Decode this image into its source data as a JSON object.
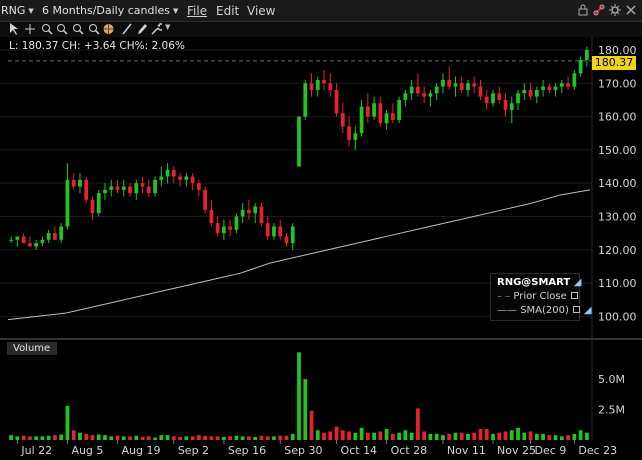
{
  "header": {
    "symbol": "RNG",
    "period": "6 Months/Daily candles",
    "menus": [
      "File",
      "Edit",
      "View"
    ]
  },
  "window_icons": [
    "lock-icon",
    "link-icon",
    "settings-icon",
    "close-icon"
  ],
  "toolbar_tools": [
    "pointer-icon",
    "crosshair-icon",
    "zoom-in-icon",
    "zoom-out-icon",
    "line-tool-icon",
    "annotate-icon",
    "wrench-icon"
  ],
  "ohlc_readout": "L: 180.37  CH: +3.64  CH%: 2.06%",
  "last_price_tag": "180.37",
  "legend": {
    "title": "RNG@SMART",
    "items": [
      {
        "label": "Prior Close",
        "checked": true
      },
      {
        "label": "SMA(200)",
        "checked": true
      }
    ]
  },
  "volume_panel": {
    "label": "Volume"
  },
  "colors": {
    "up": "#22c51e",
    "down": "#e8222a",
    "sma": "#bdbdbd",
    "price_tag": "#f3d21d",
    "grid": "#1b1b1b"
  },
  "chart_data": {
    "type": "candlestick",
    "y_ticks": [
      "180.00",
      "170.00",
      "160.00",
      "150.00",
      "140.00",
      "130.00",
      "120.00",
      "110.00",
      "100.00"
    ],
    "ylim": [
      95,
      183
    ],
    "x_ticks": [
      "Jul 22",
      "Aug 5",
      "Aug 19",
      "Sep 2",
      "Sep 16",
      "Sep 30",
      "Oct 14",
      "Oct 28",
      "Nov 11",
      "Nov 25",
      "Dec 9",
      "Dec 23"
    ],
    "volume_ticks": [
      "5.0M",
      "2.5M"
    ],
    "prior_close": 176.73,
    "sma_200": [
      99,
      100,
      101,
      103,
      105,
      107,
      109,
      111,
      113,
      116,
      118,
      120,
      122,
      124,
      126,
      128,
      130,
      132,
      134,
      136.5,
      138
    ],
    "candles": [
      [
        123,
        124,
        122,
        123
      ],
      [
        123,
        124,
        121,
        124
      ],
      [
        124,
        125,
        122,
        122
      ],
      [
        122,
        124,
        121,
        121
      ],
      [
        121,
        123,
        120,
        122
      ],
      [
        122,
        124,
        121,
        123
      ],
      [
        123,
        126,
        122,
        125
      ],
      [
        125,
        127,
        123,
        123
      ],
      [
        123,
        128,
        122,
        127
      ],
      [
        127,
        146,
        126,
        141
      ],
      [
        141,
        143,
        138,
        139
      ],
      [
        139,
        143,
        137,
        141
      ],
      [
        141,
        142,
        134,
        135
      ],
      [
        135,
        136,
        129,
        131
      ],
      [
        131,
        138,
        130,
        137
      ],
      [
        137,
        140,
        135,
        138
      ],
      [
        138,
        141,
        136,
        139
      ],
      [
        139,
        141,
        137,
        138
      ],
      [
        138,
        141,
        136,
        139
      ],
      [
        139,
        140,
        136,
        137
      ],
      [
        137,
        141,
        135,
        140
      ],
      [
        140,
        142,
        137,
        139
      ],
      [
        139,
        141,
        136,
        137
      ],
      [
        137,
        142,
        136,
        141
      ],
      [
        141,
        145,
        139,
        142
      ],
      [
        142,
        146,
        140,
        144
      ],
      [
        144,
        145,
        140,
        142
      ],
      [
        142,
        143,
        139,
        141
      ],
      [
        141,
        143,
        139,
        142
      ],
      [
        142,
        143,
        138,
        140
      ],
      [
        140,
        141,
        136,
        138
      ],
      [
        138,
        139,
        131,
        132
      ],
      [
        132,
        135,
        127,
        128
      ],
      [
        128,
        130,
        124,
        125
      ],
      [
        125,
        129,
        123,
        127
      ],
      [
        127,
        129,
        124,
        126
      ],
      [
        126,
        131,
        125,
        130
      ],
      [
        130,
        134,
        128,
        132
      ],
      [
        132,
        135,
        129,
        131
      ],
      [
        131,
        134,
        128,
        133
      ],
      [
        133,
        134,
        127,
        128
      ],
      [
        128,
        130,
        123,
        124
      ],
      [
        124,
        128,
        123,
        127
      ],
      [
        127,
        129,
        123,
        124
      ],
      [
        124,
        125,
        121,
        122
      ],
      [
        122,
        128,
        120,
        127
      ],
      [
        145,
        160,
        145,
        160
      ],
      [
        160,
        171,
        159,
        170
      ],
      [
        170,
        173,
        166,
        168
      ],
      [
        168,
        172,
        166,
        171
      ],
      [
        171,
        174,
        168,
        170
      ],
      [
        170,
        173,
        166,
        168
      ],
      [
        168,
        170,
        160,
        161
      ],
      [
        161,
        164,
        155,
        157
      ],
      [
        157,
        160,
        151,
        153
      ],
      [
        153,
        157,
        150,
        155
      ],
      [
        155,
        165,
        154,
        163
      ],
      [
        163,
        167,
        158,
        160
      ],
      [
        160,
        166,
        159,
        164
      ],
      [
        164,
        166,
        157,
        158
      ],
      [
        158,
        162,
        156,
        161
      ],
      [
        161,
        164,
        158,
        159
      ],
      [
        159,
        166,
        158,
        165
      ],
      [
        165,
        168,
        163,
        167
      ],
      [
        167,
        171,
        165,
        169
      ],
      [
        169,
        173,
        166,
        167
      ],
      [
        167,
        169,
        164,
        166
      ],
      [
        166,
        168,
        163,
        167
      ],
      [
        167,
        170,
        165,
        169
      ],
      [
        169,
        173,
        167,
        171
      ],
      [
        171,
        175,
        168,
        169
      ],
      [
        169,
        172,
        166,
        170
      ],
      [
        170,
        172,
        167,
        168
      ],
      [
        168,
        171,
        166,
        170
      ],
      [
        170,
        172,
        167,
        169
      ],
      [
        169,
        171,
        165,
        166
      ],
      [
        166,
        168,
        162,
        164
      ],
      [
        164,
        168,
        163,
        167
      ],
      [
        167,
        169,
        164,
        165
      ],
      [
        165,
        167,
        160,
        162
      ],
      [
        162,
        166,
        158,
        164
      ],
      [
        164,
        168,
        162,
        167
      ],
      [
        167,
        170,
        165,
        168
      ],
      [
        168,
        170,
        165,
        166
      ],
      [
        166,
        169,
        164,
        168
      ],
      [
        168,
        171,
        166,
        169
      ],
      [
        169,
        170,
        167,
        168
      ],
      [
        168,
        170,
        166,
        169
      ],
      [
        169,
        171,
        167,
        170
      ],
      [
        170,
        172,
        168,
        169
      ],
      [
        169,
        174,
        168,
        173
      ],
      [
        173,
        178,
        172,
        177
      ],
      [
        177,
        181,
        175,
        180
      ]
    ],
    "volume": [
      0.4,
      0.3,
      0.35,
      0.3,
      0.3,
      0.3,
      0.35,
      0.4,
      0.45,
      2.8,
      0.8,
      0.6,
      0.5,
      0.4,
      0.45,
      0.4,
      0.3,
      0.35,
      0.3,
      0.3,
      0.35,
      0.25,
      0.3,
      0.2,
      0.4,
      0.4,
      0.3,
      0.25,
      0.3,
      0.3,
      0.4,
      0.35,
      0.3,
      0.3,
      0.25,
      0.3,
      0.35,
      0.3,
      0.3,
      0.25,
      0.35,
      0.3,
      0.3,
      0.35,
      0.35,
      0.5,
      7.2,
      5.0,
      2.4,
      0.8,
      0.6,
      0.7,
      1.1,
      0.8,
      0.7,
      0.6,
      1.0,
      0.6,
      0.6,
      0.7,
      0.9,
      0.5,
      0.6,
      0.8,
      0.6,
      2.6,
      0.7,
      0.5,
      0.5,
      0.4,
      0.5,
      0.6,
      0.6,
      0.5,
      0.6,
      0.9,
      0.9,
      0.5,
      0.6,
      0.7,
      0.8,
      1.0,
      0.6,
      0.7,
      0.5,
      0.5,
      0.4,
      0.4,
      0.3,
      0.4,
      0.5,
      0.8,
      0.6
    ]
  }
}
